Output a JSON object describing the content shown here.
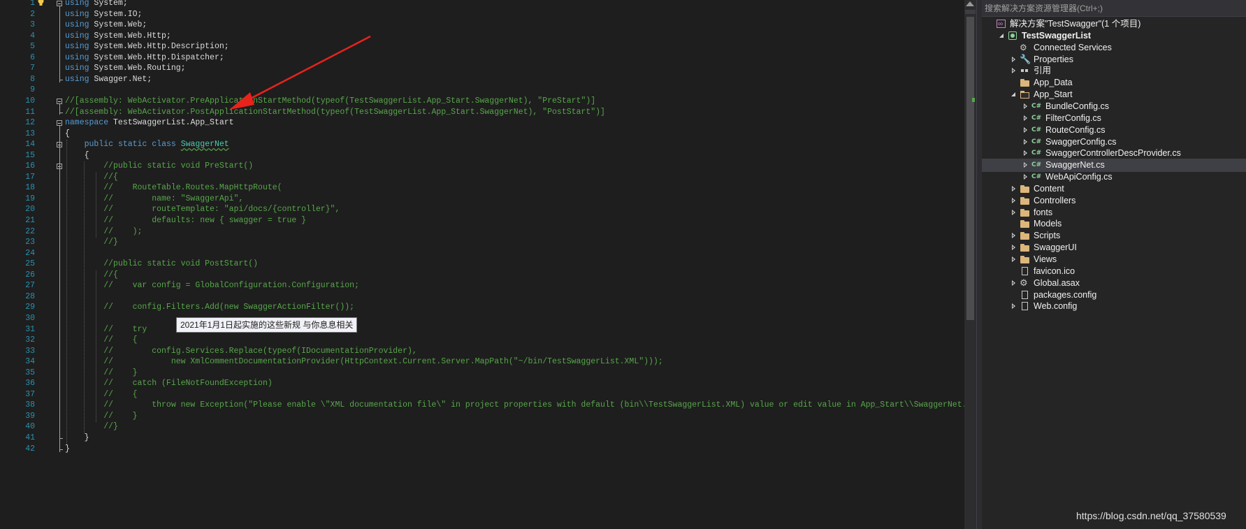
{
  "code_lines": [
    [
      {
        "t": "using",
        "c": "kw"
      },
      {
        "t": " System;"
      }
    ],
    [
      {
        "t": "using",
        "c": "kw"
      },
      {
        "t": " System.IO;"
      }
    ],
    [
      {
        "t": "using",
        "c": "kw"
      },
      {
        "t": " System.Web;"
      }
    ],
    [
      {
        "t": "using",
        "c": "kw"
      },
      {
        "t": " System.Web.Http;"
      }
    ],
    [
      {
        "t": "using",
        "c": "kw"
      },
      {
        "t": " System.Web.Http.Description;"
      }
    ],
    [
      {
        "t": "using",
        "c": "kw"
      },
      {
        "t": " System.Web.Http.Dispatcher;"
      }
    ],
    [
      {
        "t": "using",
        "c": "kw"
      },
      {
        "t": " System.Web.Routing;"
      }
    ],
    [
      {
        "t": "using",
        "c": "kw"
      },
      {
        "t": " Swagger.Net;"
      }
    ],
    [],
    [
      {
        "t": "//[assembly: WebActivator.PreApplicationStartMethod(typeof(TestSwaggerList.App_Start.SwaggerNet), \"PreStart\")]",
        "c": "cm"
      }
    ],
    [
      {
        "t": "//[assembly: WebActivator.PostApplicationStartMethod(typeof(TestSwaggerList.App_Start.SwaggerNet), \"PostStart\")]",
        "c": "cm"
      }
    ],
    [
      {
        "t": "namespace",
        "c": "kw"
      },
      {
        "t": " TestSwaggerList.App_Start"
      }
    ],
    [
      {
        "t": "{"
      }
    ],
    [
      {
        "t": "    "
      },
      {
        "t": "public",
        "c": "kw"
      },
      {
        "t": " "
      },
      {
        "t": "static",
        "c": "kw"
      },
      {
        "t": " "
      },
      {
        "t": "class",
        "c": "kw"
      },
      {
        "t": " "
      },
      {
        "t": "SwaggerNet",
        "c": "typ squig"
      }
    ],
    [
      {
        "t": "    {"
      }
    ],
    [
      {
        "t": "        //public static void PreStart()",
        "c": "cm"
      }
    ],
    [
      {
        "t": "        //{",
        "c": "cm"
      }
    ],
    [
      {
        "t": "        //    RouteTable.Routes.MapHttpRoute(",
        "c": "cm"
      }
    ],
    [
      {
        "t": "        //        name: \"SwaggerApi\",",
        "c": "cm"
      }
    ],
    [
      {
        "t": "        //        routeTemplate: \"api/docs/{controller}\",",
        "c": "cm"
      }
    ],
    [
      {
        "t": "        //        defaults: new { swagger = true }",
        "c": "cm"
      }
    ],
    [
      {
        "t": "        //    );",
        "c": "cm"
      }
    ],
    [
      {
        "t": "        //}",
        "c": "cm"
      }
    ],
    [],
    [
      {
        "t": "        //public static void PostStart()",
        "c": "cm"
      }
    ],
    [
      {
        "t": "        //{",
        "c": "cm"
      }
    ],
    [
      {
        "t": "        //    var config = GlobalConfiguration.Configuration;",
        "c": "cm"
      }
    ],
    [],
    [
      {
        "t": "        //    config.Filters.Add(new SwaggerActionFilter());",
        "c": "cm"
      }
    ],
    [],
    [
      {
        "t": "        //    try",
        "c": "cm"
      }
    ],
    [
      {
        "t": "        //    {",
        "c": "cm"
      }
    ],
    [
      {
        "t": "        //        config.Services.Replace(typeof(IDocumentationProvider),",
        "c": "cm"
      }
    ],
    [
      {
        "t": "        //            new XmlCommentDocumentationProvider(HttpContext.Current.Server.MapPath(\"~/bin/TestSwaggerList.XML\")));",
        "c": "cm"
      }
    ],
    [
      {
        "t": "        //    }",
        "c": "cm"
      }
    ],
    [
      {
        "t": "        //    catch (FileNotFoundException)",
        "c": "cm"
      }
    ],
    [
      {
        "t": "        //    {",
        "c": "cm"
      }
    ],
    [
      {
        "t": "        //        throw new Exception(\"Please enable \\\"XML documentation file\\\" in project properties with default (bin\\\\TestSwaggerList.XML) value or edit value in App_Start\\\\SwaggerNet.cs\");",
        "c": "cm"
      }
    ],
    [
      {
        "t": "        //    }",
        "c": "cm"
      }
    ],
    [
      {
        "t": "        //}",
        "c": "cm"
      }
    ],
    [
      {
        "t": "    }"
      }
    ],
    [
      {
        "t": "}"
      }
    ]
  ],
  "tooltip": "2021年1月1日起实施的这些新规 与你息息相关",
  "explorer": {
    "search_placeholder": "搜索解决方案资源管理器(Ctrl+;)",
    "items": [
      {
        "label": "解决方案\"TestSwagger\"(1 个项目)",
        "icon": "solution-icon",
        "indent": 0,
        "expander": "none",
        "bold": false
      },
      {
        "label": "TestSwaggerList",
        "icon": "project-icon",
        "indent": 1,
        "expander": "down",
        "bold": true
      },
      {
        "label": "Connected Services",
        "icon": "connected-services-icon",
        "indent": 2,
        "expander": "none",
        "bold": false
      },
      {
        "label": "Properties",
        "icon": "wrench-icon",
        "indent": 2,
        "expander": "right",
        "bold": false
      },
      {
        "label": "引用",
        "icon": "references-icon",
        "indent": 2,
        "expander": "right",
        "bold": false
      },
      {
        "label": "App_Data",
        "icon": "folder-icon",
        "indent": 2,
        "expander": "none",
        "bold": false
      },
      {
        "label": "App_Start",
        "icon": "folder-open-icon",
        "indent": 2,
        "expander": "down",
        "bold": false
      },
      {
        "label": "BundleConfig.cs",
        "icon": "csharp-file-icon",
        "indent": 3,
        "expander": "right",
        "bold": false
      },
      {
        "label": "FilterConfig.cs",
        "icon": "csharp-file-icon",
        "indent": 3,
        "expander": "right",
        "bold": false
      },
      {
        "label": "RouteConfig.cs",
        "icon": "csharp-file-icon",
        "indent": 3,
        "expander": "right",
        "bold": false
      },
      {
        "label": "SwaggerConfig.cs",
        "icon": "csharp-file-icon",
        "indent": 3,
        "expander": "right",
        "bold": false
      },
      {
        "label": "SwaggerControllerDescProvider.cs",
        "icon": "csharp-file-icon",
        "indent": 3,
        "expander": "right",
        "bold": false
      },
      {
        "label": "SwaggerNet.cs",
        "icon": "csharp-file-icon",
        "indent": 3,
        "expander": "right",
        "bold": false,
        "selected": true
      },
      {
        "label": "WebApiConfig.cs",
        "icon": "csharp-file-icon",
        "indent": 3,
        "expander": "right",
        "bold": false
      },
      {
        "label": "Content",
        "icon": "folder-icon",
        "indent": 2,
        "expander": "right",
        "bold": false
      },
      {
        "label": "Controllers",
        "icon": "folder-icon",
        "indent": 2,
        "expander": "right",
        "bold": false
      },
      {
        "label": "fonts",
        "icon": "folder-icon",
        "indent": 2,
        "expander": "right",
        "bold": false
      },
      {
        "label": "Models",
        "icon": "folder-icon",
        "indent": 2,
        "expander": "none",
        "bold": false
      },
      {
        "label": "Scripts",
        "icon": "folder-icon",
        "indent": 2,
        "expander": "right",
        "bold": false
      },
      {
        "label": "SwaggerUI",
        "icon": "folder-icon",
        "indent": 2,
        "expander": "right",
        "bold": false
      },
      {
        "label": "Views",
        "icon": "folder-icon",
        "indent": 2,
        "expander": "right",
        "bold": false
      },
      {
        "label": "favicon.ico",
        "icon": "image-file-icon",
        "indent": 2,
        "expander": "none",
        "bold": false
      },
      {
        "label": "Global.asax",
        "icon": "gear-file-icon",
        "indent": 2,
        "expander": "right",
        "bold": false
      },
      {
        "label": "packages.config",
        "icon": "config-file-icon",
        "indent": 2,
        "expander": "none",
        "bold": false
      },
      {
        "label": "Web.config",
        "icon": "config-file-icon",
        "indent": 2,
        "expander": "right",
        "bold": false
      }
    ]
  },
  "watermark": "https://blog.csdn.net/qq_37580539",
  "colors": {
    "keyword": "#569cd6",
    "comment": "#57a64a",
    "type": "#4ec9b0",
    "line_number": "#2b91af",
    "editor_bg": "#1e1e1e",
    "explorer_bg": "#252526",
    "selection": "#3f3f46",
    "arrow": "#e8231c"
  }
}
